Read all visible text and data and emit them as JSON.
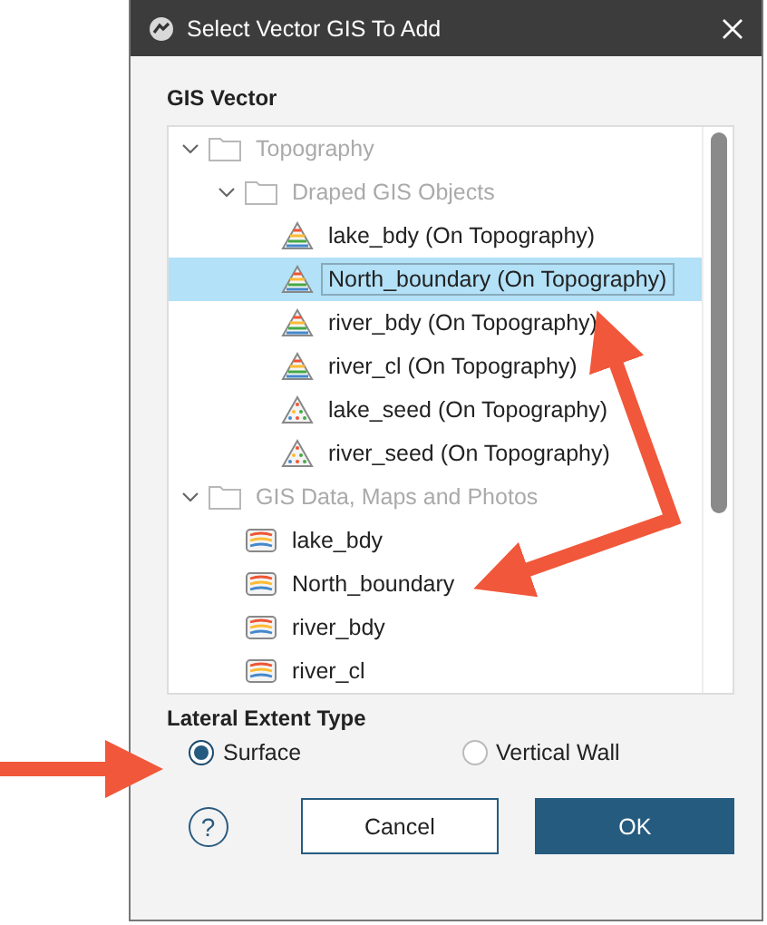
{
  "window": {
    "title": "Select Vector GIS To Add"
  },
  "tree_label": "GIS Vector",
  "tree": [
    {
      "label": "Topography",
      "kind": "folder",
      "expanded": true,
      "disabled": true,
      "selected": false,
      "children": [
        {
          "label": "Draped GIS Objects",
          "kind": "folder",
          "expanded": true,
          "disabled": true,
          "selected": false,
          "children": [
            {
              "label": "lake_bdy (On Topography)",
              "kind": "draped-lines",
              "disabled": false,
              "selected": false
            },
            {
              "label": "North_boundary (On Topography)",
              "kind": "draped-lines",
              "disabled": false,
              "selected": true
            },
            {
              "label": "river_bdy (On Topography)",
              "kind": "draped-lines",
              "disabled": false,
              "selected": false
            },
            {
              "label": "river_cl (On Topography)",
              "kind": "draped-lines",
              "disabled": false,
              "selected": false
            },
            {
              "label": "lake_seed (On Topography)",
              "kind": "draped-points",
              "disabled": false,
              "selected": false
            },
            {
              "label": "river_seed (On Topography)",
              "kind": "draped-points",
              "disabled": false,
              "selected": false
            }
          ]
        }
      ]
    },
    {
      "label": "GIS Data, Maps and Photos",
      "kind": "folder",
      "expanded": true,
      "disabled": true,
      "selected": false,
      "children": [
        {
          "label": "lake_bdy",
          "kind": "map",
          "disabled": false,
          "selected": false
        },
        {
          "label": "North_boundary",
          "kind": "map",
          "disabled": false,
          "selected": false
        },
        {
          "label": "river_bdy",
          "kind": "map",
          "disabled": false,
          "selected": false
        },
        {
          "label": "river_cl",
          "kind": "map",
          "disabled": false,
          "selected": false
        }
      ]
    }
  ],
  "extent_label": "Lateral Extent Type",
  "extent_options": [
    {
      "label": "Surface",
      "selected": true
    },
    {
      "label": "Vertical Wall",
      "selected": false
    }
  ],
  "help": "?",
  "buttons": [
    {
      "label": "Cancel",
      "kind": "secondary"
    },
    {
      "label": "OK",
      "kind": "primary"
    }
  ]
}
